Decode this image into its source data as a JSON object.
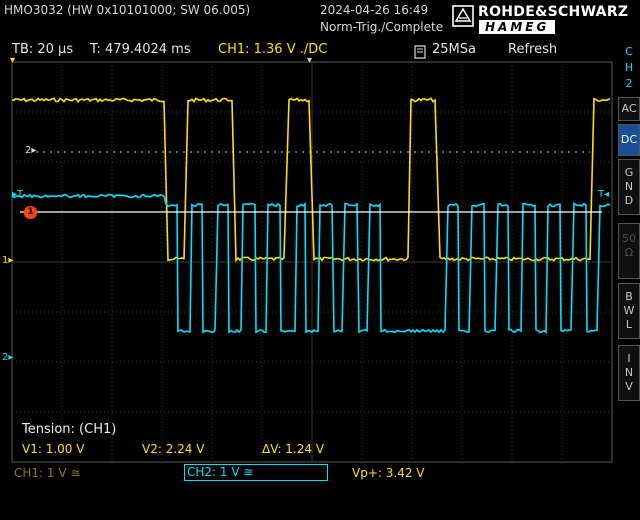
{
  "header": {
    "device": "HMO3032 (HW 0x10101000; SW 06.005)",
    "datetime": "2024-04-26 16:49",
    "trigger_status": "Norm-Trig./Complete",
    "brand_top": "ROHDE&SCHWARZ",
    "brand_bottom": "HAMEG"
  },
  "statusbar": {
    "timebase": "TB: 20 µs",
    "trigger_time": "T: 479.4024 ms",
    "ch1_setting": "CH1: 1.36 V ./DC",
    "sample_rate": "25MSa",
    "mode": "Refresh"
  },
  "side_menu": {
    "channel": [
      "C",
      "H",
      "2"
    ],
    "items": [
      {
        "label": [
          "AC"
        ],
        "state": "normal"
      },
      {
        "label": [
          "DC"
        ],
        "state": "active"
      },
      {
        "label": [
          "G",
          "N",
          "D"
        ],
        "state": "normal"
      },
      {
        "label": [
          "50",
          "Ω"
        ],
        "state": "dim"
      },
      {
        "label": [
          "B",
          "W",
          "L"
        ],
        "state": "normal"
      },
      {
        "label": [
          "I",
          "N",
          "V"
        ],
        "state": "normal"
      }
    ]
  },
  "markers": {
    "ref2": "2▸",
    "ch1_left": "1▸",
    "ch2_left": "2▸",
    "trigger_left": "▸T",
    "trigger_right": "T◂",
    "top_trigger": "▾",
    "cursor_tag": "1"
  },
  "measurement": {
    "title": "Tension: (CH1)",
    "v1": "V1: 1.00 V",
    "v2": "V2: 2.24 V",
    "dv": "ΔV: 1.24 V"
  },
  "bottom": {
    "ch1": "CH1: 1 V ≅",
    "ch2": "CH2: 1 V ≅",
    "vp": "Vp+: 3.42 V"
  },
  "colors": {
    "ch1": "#ffe000",
    "ch2": "#00e0ff",
    "grid": "#3a3a3a",
    "cursor": "#ffffff",
    "marker": "#ff4010"
  }
}
